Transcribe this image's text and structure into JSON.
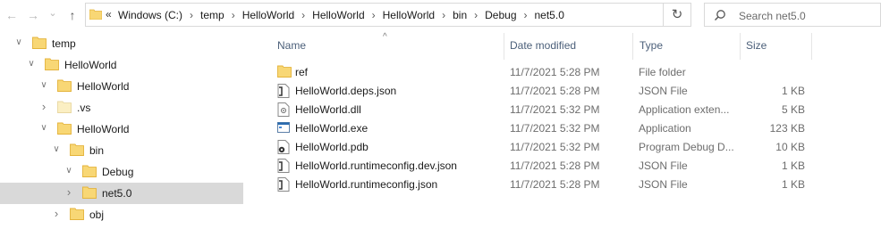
{
  "address_bar": {
    "overflow_chevron": "«",
    "crumbs": [
      "Windows (C:)",
      "temp",
      "HelloWorld",
      "HelloWorld",
      "HelloWorld",
      "bin",
      "Debug",
      "net5.0"
    ],
    "separator": "›",
    "dropdown_glyph": "⌄",
    "refresh_glyph": "↻"
  },
  "search": {
    "placeholder": "Search net5.0"
  },
  "nav": {
    "back": "←",
    "forward": "→",
    "recent": "⌄",
    "up": "↑"
  },
  "tree": [
    {
      "label": "temp",
      "expanded": true
    },
    {
      "label": "HelloWorld",
      "expanded": true
    },
    {
      "label": "HelloWorld",
      "expanded": true
    },
    {
      "label": ".vs",
      "expanded": false
    },
    {
      "label": "HelloWorld",
      "expanded": true
    },
    {
      "label": "bin",
      "expanded": true
    },
    {
      "label": "Debug",
      "expanded": true
    },
    {
      "label": "net5.0",
      "expanded": false,
      "selected": true
    },
    {
      "label": "obj",
      "expanded": false
    }
  ],
  "columns": {
    "name": "Name",
    "date": "Date modified",
    "type": "Type",
    "size": "Size"
  },
  "files": [
    {
      "name": "ref",
      "date": "11/7/2021 5:28 PM",
      "type": "File folder",
      "size": "",
      "icon": "folder-icon"
    },
    {
      "name": "HelloWorld.deps.json",
      "date": "11/7/2021 5:28 PM",
      "type": "JSON File",
      "size": "1 KB",
      "icon": "json-file-icon"
    },
    {
      "name": "HelloWorld.dll",
      "date": "11/7/2021 5:32 PM",
      "type": "Application exten...",
      "size": "5 KB",
      "icon": "dll-file-icon"
    },
    {
      "name": "HelloWorld.exe",
      "date": "11/7/2021 5:32 PM",
      "type": "Application",
      "size": "123 KB",
      "icon": "exe-file-icon"
    },
    {
      "name": "HelloWorld.pdb",
      "date": "11/7/2021 5:32 PM",
      "type": "Program Debug D...",
      "size": "10 KB",
      "icon": "pdb-file-icon"
    },
    {
      "name": "HelloWorld.runtimeconfig.dev.json",
      "date": "11/7/2021 5:28 PM",
      "type": "JSON File",
      "size": "1 KB",
      "icon": "json-file-icon"
    },
    {
      "name": "HelloWorld.runtimeconfig.json",
      "date": "11/7/2021 5:28 PM",
      "type": "JSON File",
      "size": "1 KB",
      "icon": "json-file-icon"
    }
  ],
  "colors": {
    "folder": "#f8d775",
    "folder_dark": "#e4b33a",
    "selected_row": "#d9d9d9",
    "header_text": "#4c607a"
  }
}
